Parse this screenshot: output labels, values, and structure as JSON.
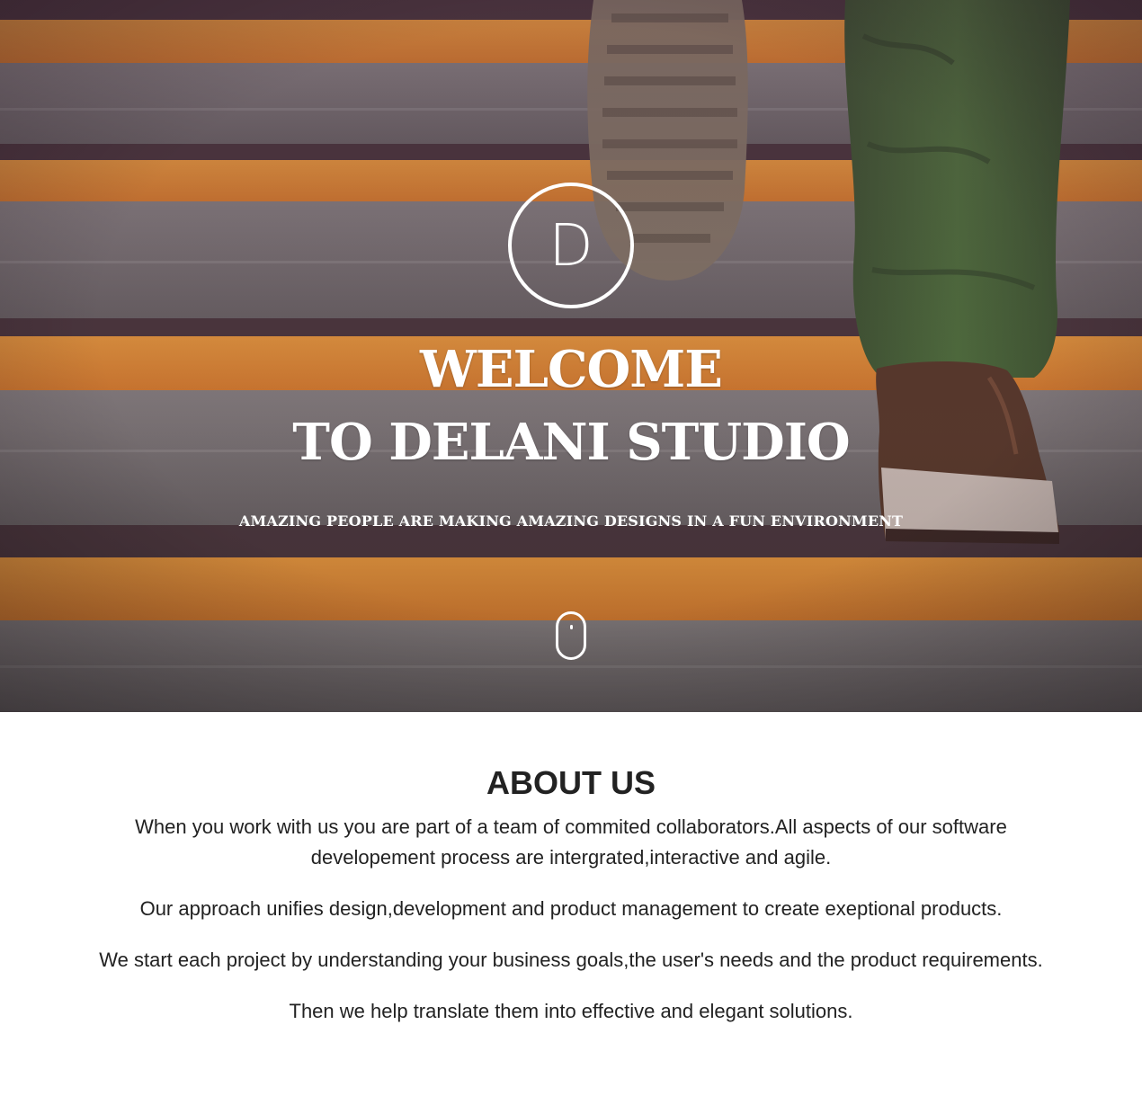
{
  "hero": {
    "logo_letter": "D",
    "title_line1": "WELCOME",
    "title_line2": "TO DELANI STUDIO",
    "subtitle": "AMAZING PEOPLE ARE MAKING AMAZING DESIGNS IN A FUN ENVIRONMENT"
  },
  "about": {
    "title": "ABOUT US",
    "paragraphs": [
      "When you work with us you are part of a team of commited collaborators.All aspects of our software developement process are intergrated,interactive and agile.",
      "Our approach unifies design,development and product management to create exeptional products.",
      "We start each project by understanding your business goals,the user's needs and the product requirements.",
      "Then we help translate them into effective and elegant solutions."
    ]
  },
  "colors": {
    "stair_orange": "#f0962a",
    "stair_gray": "#7d7c76",
    "text_dark": "#222222",
    "white": "#ffffff"
  }
}
